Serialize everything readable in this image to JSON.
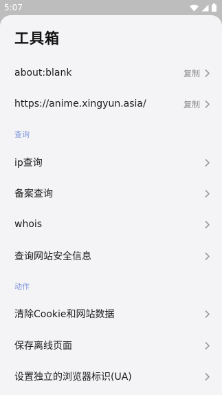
{
  "status_bar": {
    "time": "5:07"
  },
  "sheet": {
    "title": "工具箱"
  },
  "urls": [
    {
      "label": "about:blank",
      "action": "复制"
    },
    {
      "label": "https://anime.xingyun.asia/",
      "action": "复制"
    }
  ],
  "sections": {
    "query": {
      "header": "查询",
      "items": [
        "ip查询",
        "备案查询",
        "whois",
        "查询网站安全信息"
      ]
    },
    "action": {
      "header": "动作",
      "items": [
        "清除Cookie和网站数据",
        "保存离线页面",
        "设置独立的浏览器标识(UA)"
      ]
    }
  },
  "colors": {
    "accent": "#7f95dc",
    "background": "#f4f4f6"
  }
}
